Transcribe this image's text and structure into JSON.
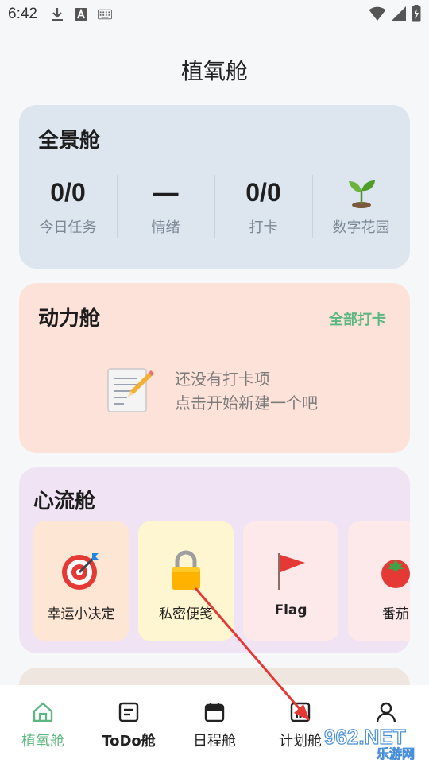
{
  "status_bar": {
    "time": "6:42",
    "icons": [
      "download-icon",
      "text-a-icon",
      "keyboard-icon",
      "wifi-icon",
      "signal-icon",
      "battery-icon"
    ]
  },
  "page_title": "植氧舱",
  "panorama": {
    "title": "全景舱",
    "stats": [
      {
        "value": "0/0",
        "label": "今日任务"
      },
      {
        "value": "—",
        "label": "情绪"
      },
      {
        "value": "0/0",
        "label": "打卡"
      },
      {
        "value": "",
        "label": "数字花园",
        "icon": "seedling-icon"
      }
    ]
  },
  "power": {
    "title": "动力舱",
    "checkin_all": "全部打卡",
    "empty_line1": "还没有打卡项",
    "empty_line2": "点击开始新建一个吧"
  },
  "flow": {
    "title": "心流舱",
    "tiles": [
      {
        "label": "幸运小决定",
        "icon": "target-icon",
        "bg": "#fde6d4"
      },
      {
        "label": "私密便笺",
        "icon": "lock-icon",
        "bg": "#fdf6d0"
      },
      {
        "label": "Flag",
        "icon": "flag-icon",
        "bg": "#fde8ea"
      },
      {
        "label": "番茄",
        "icon": "tomato-icon",
        "bg": "#fde8ea"
      }
    ]
  },
  "bottom_nav": [
    {
      "label": "植氧舱",
      "icon": "house-icon",
      "active": true
    },
    {
      "label": "ToDo舱",
      "icon": "todo-icon",
      "active": false
    },
    {
      "label": "日程舱",
      "icon": "calendar-icon",
      "active": false
    },
    {
      "label": "计划舱",
      "icon": "chart-icon",
      "active": false
    },
    {
      "label": "",
      "icon": "person-icon",
      "active": false
    }
  ],
  "watermark": {
    "line1": "962.NET",
    "line2": "乐游网"
  },
  "colors": {
    "accent": "#5cb780",
    "panorama_bg": "#dde6ef",
    "power_bg": "#fde2d9",
    "flow_bg": "#f0e3f3",
    "arrow": "#e53935"
  }
}
